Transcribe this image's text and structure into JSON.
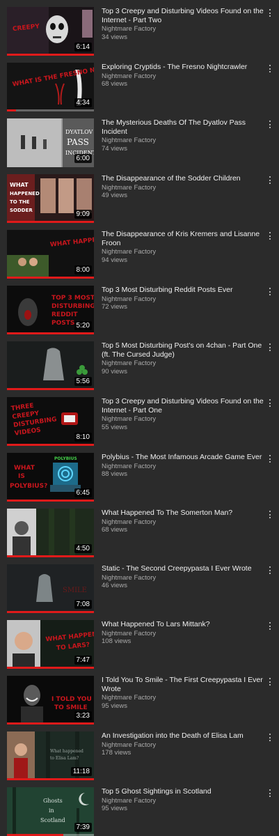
{
  "videos": [
    {
      "title": "Top 3 Creepy and Disturbing Videos Found on the Internet - Part Two",
      "channel": "Nightmare Factory",
      "views": "34 views",
      "duration": "6:14",
      "watched": 1.0,
      "thumb_icon": "skull-face-icon"
    },
    {
      "title": "Exploring Cryptids - The Fresno Nightcrawler",
      "channel": "Nightmare Factory",
      "views": "68 views",
      "duration": "4:34",
      "watched": 0.1,
      "thumb_icon": "cryptid-figure-icon"
    },
    {
      "title": "The Mysterious Deaths Of The Dyatlov Pass Incident",
      "channel": "Nightmare Factory",
      "views": "74 views",
      "duration": "6:00",
      "watched": 0.0,
      "thumb_icon": "snow-expedition-icon"
    },
    {
      "title": "The Disappearance of the Sodder Children",
      "channel": "Nightmare Factory",
      "views": "49 views",
      "duration": "9:09",
      "watched": 1.0,
      "thumb_icon": "children-portraits-icon"
    },
    {
      "title": "The Disappearance of Kris Kremers and Lisanne Froon",
      "channel": "Nightmare Factory",
      "views": "94 views",
      "duration": "8:00",
      "watched": 1.0,
      "thumb_icon": "portrait-photo-icon"
    },
    {
      "title": "Top 3 Most Disturbing Reddit Posts Ever",
      "channel": "Nightmare Factory",
      "views": "72 views",
      "duration": "5:20",
      "watched": 1.0,
      "thumb_icon": "screaming-figure-icon"
    },
    {
      "title": "Top 5 Most Disturbing Post's on 4chan - Part One (ft. The Cursed Judge)",
      "channel": "Nightmare Factory",
      "views": "90 views",
      "duration": "5:56",
      "watched": 1.0,
      "thumb_icon": "ghost-icon"
    },
    {
      "title": "Top 3 Creepy and Disturbing Videos Found on the Internet - Part One",
      "channel": "Nightmare Factory",
      "views": "55 views",
      "duration": "8:10",
      "watched": 1.0,
      "thumb_icon": "tv-static-icon"
    },
    {
      "title": "Polybius - The Most Infamous Arcade Game Ever",
      "channel": "Nightmare Factory",
      "views": "88 views",
      "duration": "6:45",
      "watched": 1.0,
      "thumb_icon": "arcade-cabinet-icon"
    },
    {
      "title": "What Happened To The Somerton Man?",
      "channel": "Nightmare Factory",
      "views": "68 views",
      "duration": "4:50",
      "watched": 1.0,
      "thumb_icon": "portrait-photo-icon"
    },
    {
      "title": "Static - The Second Creepypasta I Ever Wrote",
      "channel": "Nightmare Factory",
      "views": "46 views",
      "duration": "7:08",
      "watched": 1.0,
      "thumb_icon": "ghost-icon"
    },
    {
      "title": "What Happened To Lars Mittank?",
      "channel": "Nightmare Factory",
      "views": "108 views",
      "duration": "7:47",
      "watched": 1.0,
      "thumb_icon": "portrait-photo-icon"
    },
    {
      "title": "I Told You To Smile - The First Creepypasta I Ever Wrote",
      "channel": "Nightmare Factory",
      "views": "95 views",
      "duration": "3:23",
      "watched": 1.0,
      "thumb_icon": "smiling-figure-icon"
    },
    {
      "title": "An Investigation into the Death of Elisa Lam",
      "channel": "Nightmare Factory",
      "views": "178 views",
      "duration": "11:18",
      "watched": 1.0,
      "thumb_icon": "portrait-photo-icon"
    },
    {
      "title": "Top 5 Ghost Sightings in Scotland",
      "channel": "Nightmare Factory",
      "views": "95 views",
      "duration": "7:39",
      "watched": 0.65,
      "thumb_icon": "moon-forest-icon"
    }
  ],
  "thumb_text": {
    "v0": "CREEPY",
    "v1": "WHAT IS THE FRESNO NIGHTCRAWLER?",
    "v2a": "DYATLOV",
    "v2b": "PASS",
    "v2c": "INCIDENT",
    "v3a": "WHAT",
    "v3b": "HAPPENED",
    "v3c": "TO THE",
    "v3d": "SODDER",
    "v4": "WHAT HAPPENED TO KRIS AND LISANNE?",
    "v5a": "TOP 3 MOST",
    "v5b": "DISTURBING",
    "v5c": "REDDIT",
    "v5d": "POSTS",
    "v7a": "THREE",
    "v7b": "CREEPY",
    "v7c": "DISTURBING",
    "v7d": "VIDEOS",
    "v8a": "WHAT",
    "v8b": "IS",
    "v8c": "POLYBIUS?",
    "v8d": "POLYBIUS",
    "v10": "SMILE",
    "v11a": "WHAT HAPPENED",
    "v11b": "TO LARS?",
    "v12a": "I TOLD YOU",
    "v12b": "TO SMILE",
    "v13a": "What happened",
    "v13b": "to Elisa Lam?",
    "v14a": "Ghosts",
    "v14b": "in",
    "v14c": "Scotland"
  },
  "colors": {
    "background": "#2b2b2b",
    "progress": "#e01a1a",
    "secondary_text": "#aaaaaa",
    "thumb_red_text": "#c8161d"
  }
}
